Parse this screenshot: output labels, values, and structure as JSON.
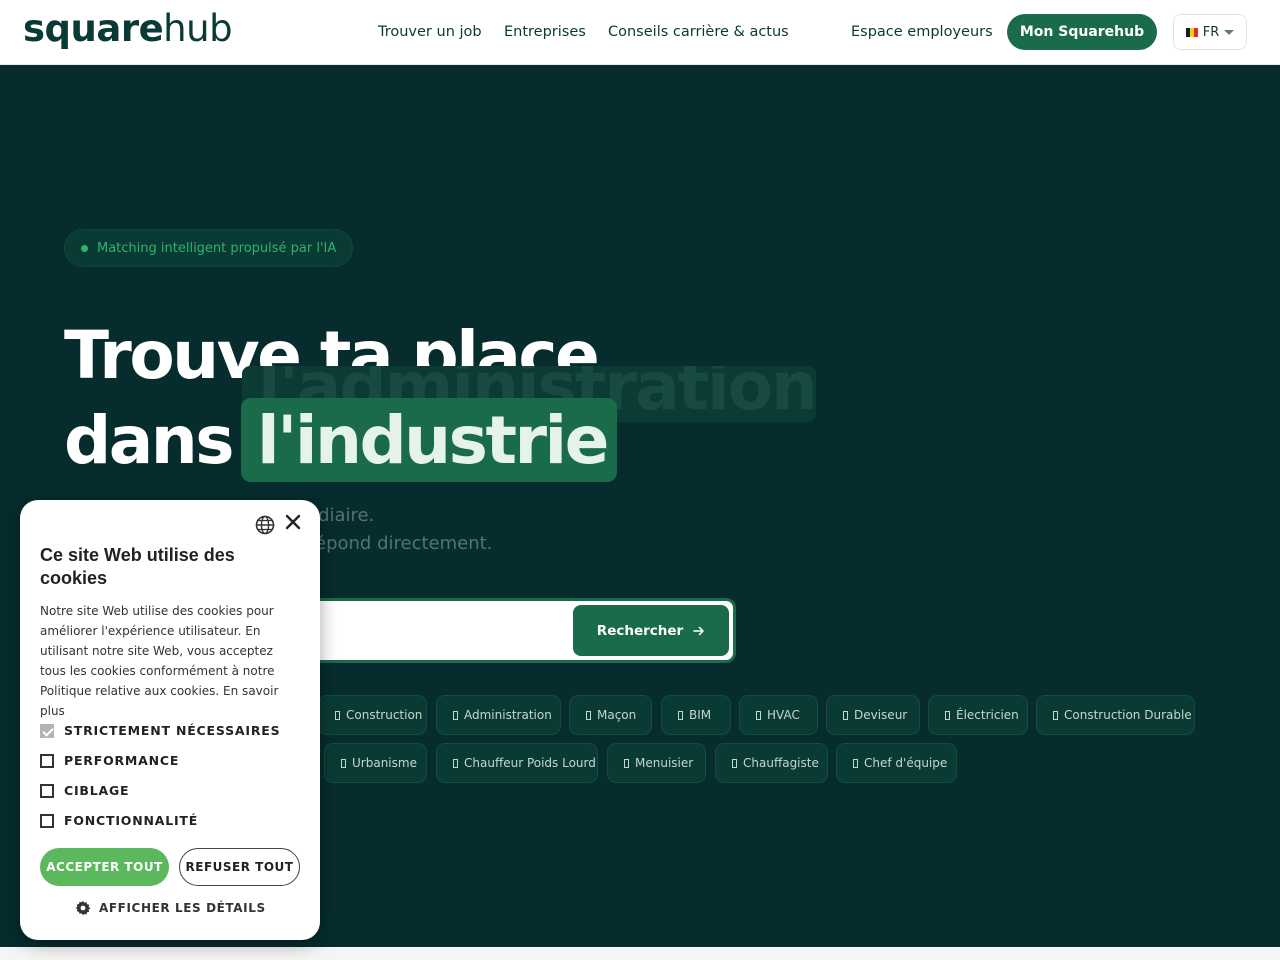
{
  "header": {
    "logo_part1": "square",
    "logo_part2": "hub",
    "nav": [
      "Trouver un job",
      "Entreprises",
      "Conseils carrière & actus",
      "Espace employeurs"
    ],
    "cta": "Mon Squarehub",
    "lang": "FR"
  },
  "hero": {
    "badge": "Matching intelligent propulsé par l'IA",
    "title_line1": "Trouve ta place",
    "title_line2_prefix": "dans",
    "rotating_word": "l'industrie",
    "rotating_word_ghost": "l'administration",
    "subtitle_line1": "Pas d'agence, pas d'intermédiaire.",
    "subtitle_line2": "Tu postules, l'entreprise te répond directement.",
    "search_placeholder": "",
    "search_button": "Rechercher",
    "chips_row1": [
      "Construction",
      "Administration",
      "Maçon",
      "BIM",
      "HVAC",
      "Deviseur",
      "Électricien",
      "Construction Durable"
    ],
    "chips_row2": [
      "Urbanisme",
      "Chauffeur Poids Lourd",
      "Menuisier",
      "Chauffagiste",
      "Chef d'équipe"
    ]
  },
  "cookie": {
    "title": "Ce site Web utilise des cookies",
    "body": "Notre site Web utilise des cookies pour améliorer l'expérience utilisateur. En utilisant notre site Web, vous acceptez tous les cookies conformément à notre Politique relative aux cookies. En savoir plus",
    "options": [
      "STRICTEMENT NÉCESSAIRES",
      "PERFORMANCE",
      "CIBLAGE",
      "FONCTIONNALITÉ"
    ],
    "accept": "ACCEPTER TOUT",
    "refuse": "REFUSER TOUT",
    "details": "AFFICHER LES DÉTAILS"
  },
  "colors": {
    "brand_dark": "#062c2d",
    "brand_green": "#1a6b4a",
    "accent_green": "#2fb36a",
    "cookie_accept": "#5cb85c"
  },
  "icons": [
    "globe-icon",
    "close-icon",
    "arrow-right-icon",
    "gear-icon",
    "chevron-down-icon",
    "flag-be-icon"
  ]
}
